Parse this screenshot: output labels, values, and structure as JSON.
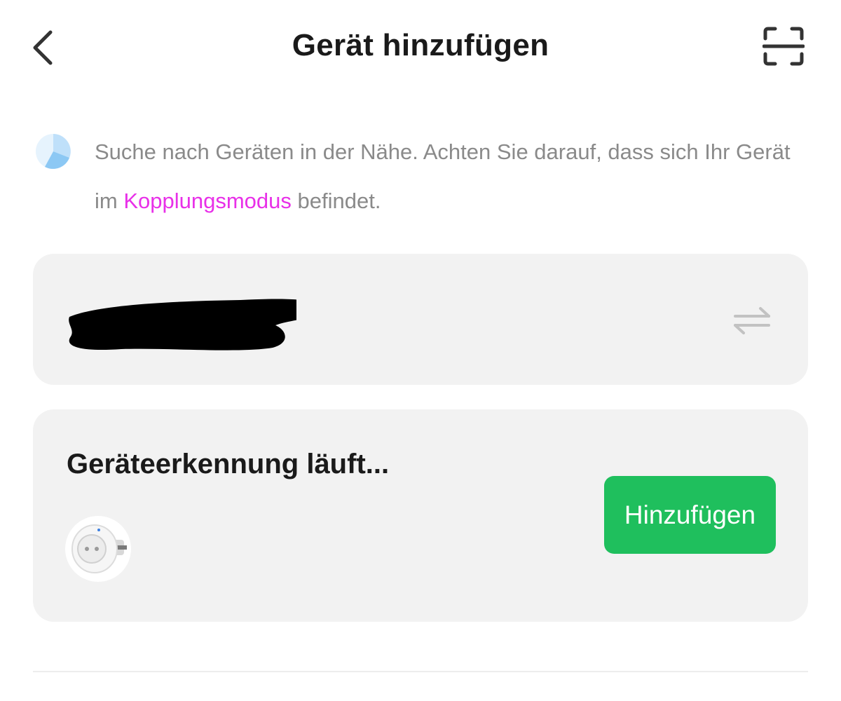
{
  "header": {
    "title": "Gerät hinzufügen",
    "back_icon": "chevron-left-icon",
    "scan_icon": "scan-icon"
  },
  "hint": {
    "icon": "loading-spinner-icon",
    "text_before": "Suche nach Geräten in der Nähe. Achten Sie darauf, dass sich Ihr Gerät im ",
    "link_text": "Kopplungsmodus",
    "text_after": " befindet."
  },
  "wifi": {
    "network_name": "",
    "redacted": true,
    "switch_icon": "swap-arrows-icon"
  },
  "discovery": {
    "title": "Geräteerkennung läuft...",
    "device_icon": "smart-plug-image",
    "add_button_label": "Hinzufügen"
  },
  "colors": {
    "accent_link": "#e830e8",
    "button_green": "#1fbf5d",
    "card_bg": "#f2f2f2",
    "hint_text": "#8a8a8a"
  }
}
